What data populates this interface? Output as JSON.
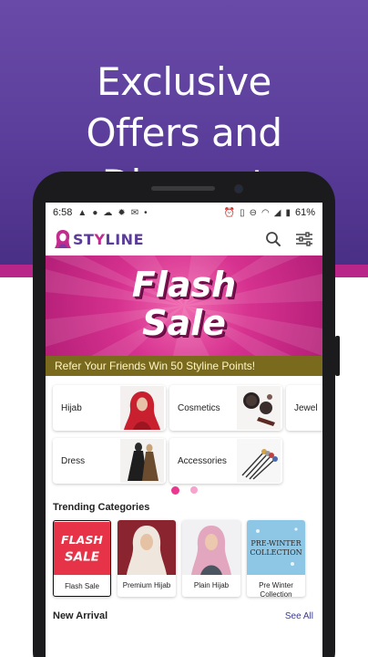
{
  "promo": {
    "line1": "Exclusive",
    "line2": "Offers and Discount"
  },
  "status_bar": {
    "time": "6:58",
    "battery": "61%"
  },
  "app": {
    "logo_main": "ST",
    "logo_accent": "Y",
    "logo_rest": "LINE",
    "brand_color": "#5b3c9a",
    "accent_color": "#c22c8e"
  },
  "banner": {
    "line1": "Flash",
    "line2": "Sale"
  },
  "refer_text": "Refer Your Friends Win 50 Styline Points!",
  "categories": [
    {
      "label": "Hijab"
    },
    {
      "label": "Cosmetics"
    },
    {
      "label": "Jewel"
    },
    {
      "label": "Dress"
    },
    {
      "label": "Accessories"
    }
  ],
  "pager": {
    "count": 2,
    "active": 0
  },
  "trending": {
    "title": "Trending Categories",
    "items": [
      {
        "label": "Flash Sale",
        "img_line1": "FLASH",
        "img_line2": "SALE"
      },
      {
        "label": "Premium Hijab"
      },
      {
        "label": "Plain Hijab"
      },
      {
        "label": "Pre Winter Collection",
        "img_line1": "PRE-WINTER",
        "img_line2": "COLLECTION"
      }
    ]
  },
  "new_arrival": {
    "title": "New Arrival",
    "see_all": "See All"
  }
}
